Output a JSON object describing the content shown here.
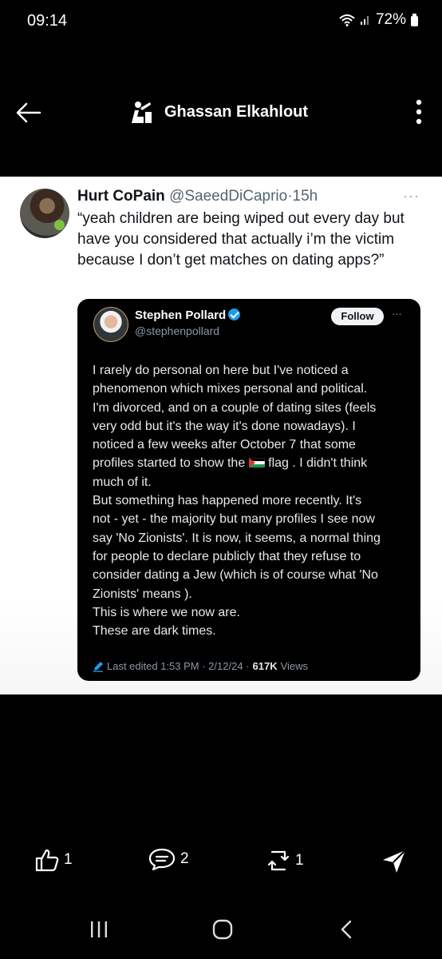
{
  "status_bar": {
    "time": "09:14",
    "battery": "72%"
  },
  "header": {
    "title": "Ghassan Elkahlout"
  },
  "tweet": {
    "name": "Hurt CoPain",
    "handle": "@SaeedDiCaprio",
    "separator": "·",
    "time": "15h",
    "more": "···",
    "text": "“yeah children are being wiped out every day but have you considered that actually i’m the victim because I don’t get matches on dating apps?”"
  },
  "quote": {
    "name": "Stephen Pollard",
    "handle": "@stephenpollard",
    "follow_label": "Follow",
    "more": "···",
    "lines": [
      "I rarely do personal on here but I've noticed a",
      "phenomenon which mixes personal and political.",
      "I'm divorced, and on a couple of dating sites (feels",
      "very odd but it's the way it's done nowadays). I",
      "noticed a few weeks after October 7 that some",
      "profiles started to show the",
      "flag . I didn't think",
      "much of it.",
      "But something has happened more recently. It's",
      "not - yet - the majority but many profiles I see now",
      "say 'No Zionists'. It is now, it seems, a normal thing",
      "for people to declare publicly that they refuse to",
      "consider dating a Jew (which is of course what 'No",
      "Zionists' means ).",
      "This is where we now are.",
      "These are dark times."
    ],
    "edited": "Last edited 1:53 PM · 2/12/24 ·",
    "views_count": "617K",
    "views_label": "Views"
  },
  "actions": {
    "likes": "1",
    "comments": "2",
    "reposts": "1"
  },
  "icons": {
    "back": "back-arrow-icon",
    "kebab": "more-vertical-icon",
    "like": "thumbs-up-icon",
    "comment": "comment-icon",
    "repost": "repost-icon",
    "share": "send-icon"
  }
}
